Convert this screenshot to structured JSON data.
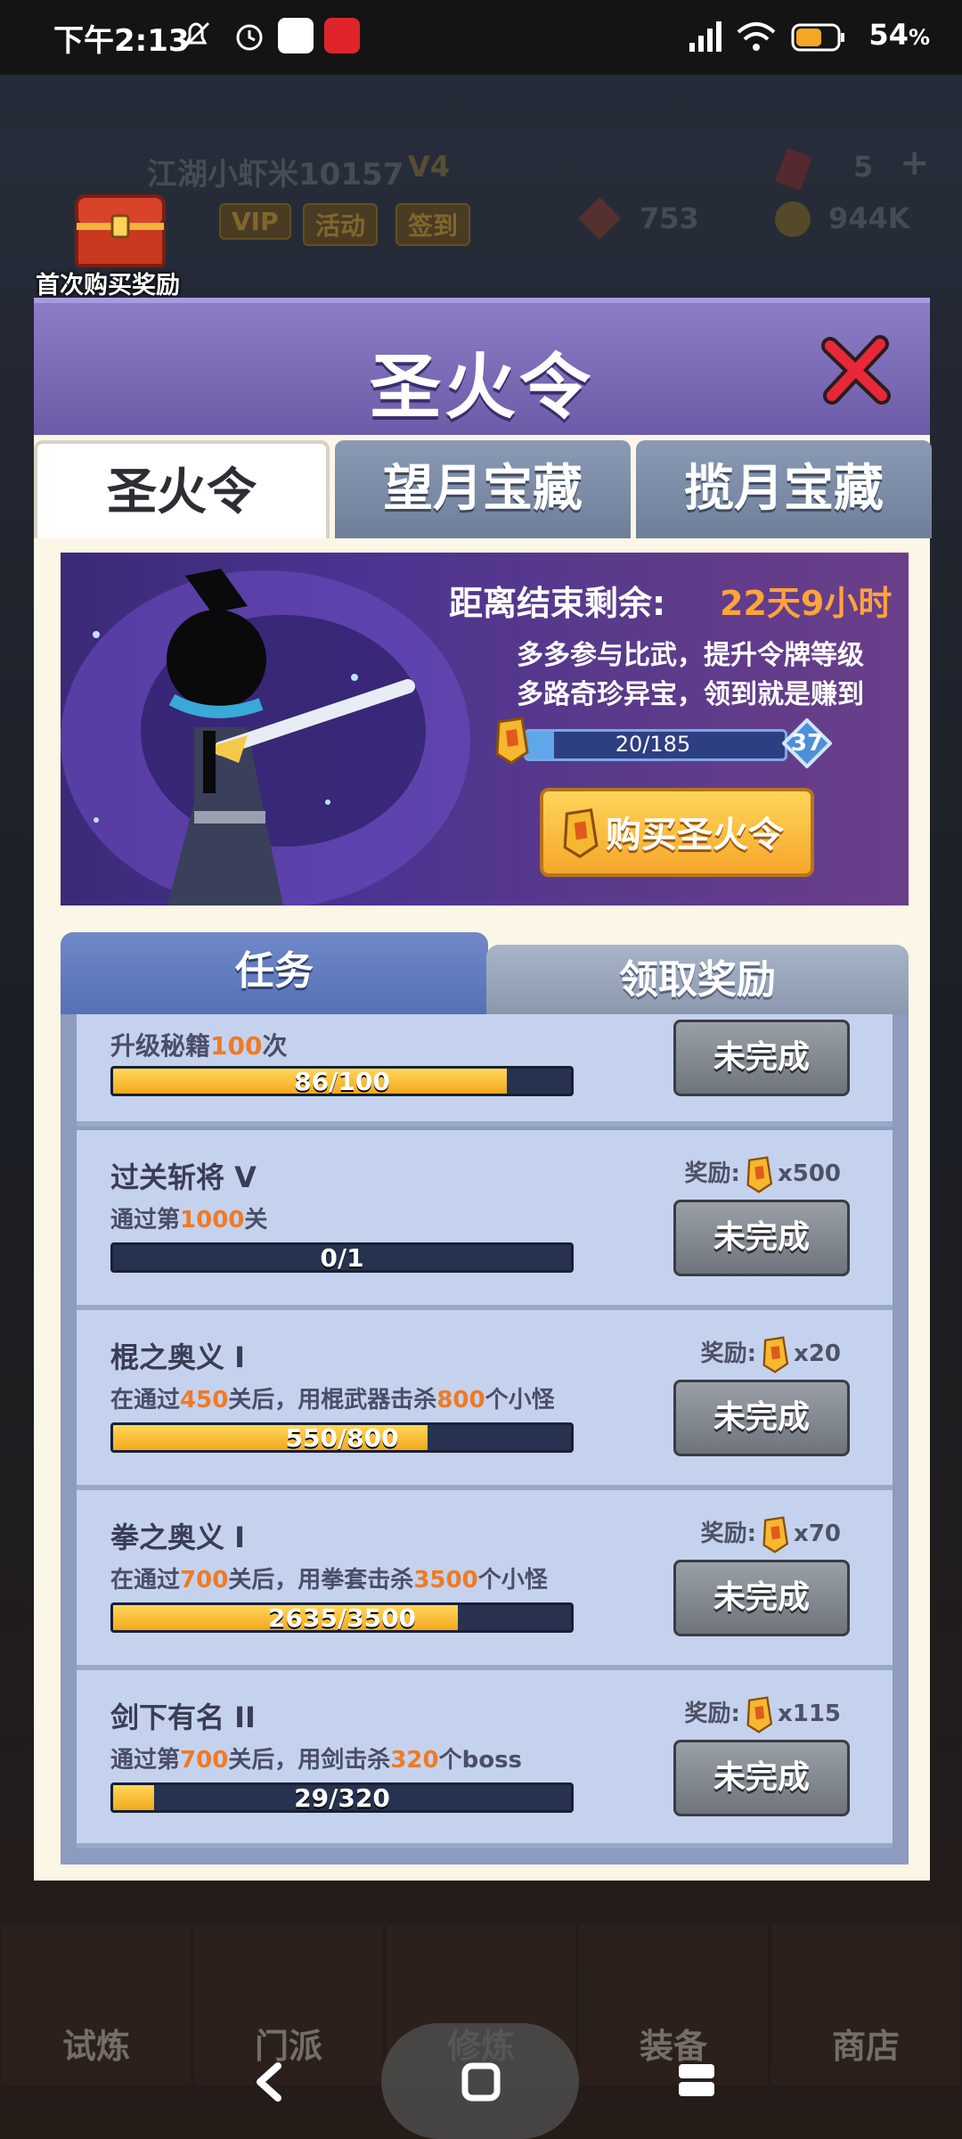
{
  "status_bar": {
    "time": "下午2:13",
    "battery": "54",
    "battery_unit": "%"
  },
  "background": {
    "player_name": "江湖小虾米10157",
    "vip_level": "V4",
    "buttons": [
      "VIP",
      "活动",
      "签到"
    ],
    "gems": "5",
    "currency_a": "753",
    "currency_b": "944K",
    "first_buy_label": "首次购买奖励"
  },
  "modal": {
    "title": "圣火令",
    "tabs": [
      "圣火令",
      "望月宝藏",
      "揽月宝藏"
    ],
    "active_tab": 0,
    "banner": {
      "remaining_label": "距离结束剩余:",
      "remaining_value": "22天9小时",
      "slogan1": "多多参与比武，提升令牌等级",
      "slogan2": "多路奇珍异宝，领到就是赚到",
      "progress_text": "20/185",
      "progress": 0.108,
      "level": "37",
      "buy_label": "购买圣火令"
    },
    "section_tabs": {
      "tasks": "任务",
      "rewards": "领取奖励"
    },
    "tasks": [
      {
        "title": "",
        "desc": [
          "升级秘籍",
          "100",
          "次"
        ],
        "progress_text": "86/100",
        "progress": 0.86,
        "reward": "",
        "status": "未完成"
      },
      {
        "title": "过关斩将 V",
        "desc": [
          "通过第",
          "1000",
          "关"
        ],
        "progress_text": "0/1",
        "progress": 0.0,
        "reward_label": "奖励:",
        "reward": "x500",
        "status": "未完成"
      },
      {
        "title": "棍之奥义 I",
        "desc": [
          "在通过",
          "450",
          "关后，用棍武器击杀",
          "800",
          "个小怪"
        ],
        "progress_text": "550/800",
        "progress": 0.6875,
        "reward_label": "奖励:",
        "reward": "x20",
        "status": "未完成"
      },
      {
        "title": "拳之奥义 I",
        "desc": [
          "在通过",
          "700",
          "关后，用拳套击杀",
          "3500",
          "个小怪"
        ],
        "progress_text": "2635/3500",
        "progress": 0.753,
        "reward_label": "奖励:",
        "reward": "x70",
        "status": "未完成"
      },
      {
        "title": "剑下有名 II",
        "desc": [
          "通过第",
          "700",
          "关后，用剑击杀",
          "320",
          "个boss"
        ],
        "progress_text": "29/320",
        "progress": 0.09,
        "reward_label": "奖励:",
        "reward": "x115",
        "status": "未完成"
      }
    ]
  },
  "bottom_nav": [
    "试炼",
    "门派",
    "修炼",
    "装备",
    "商店"
  ],
  "colors": {
    "accent": "#f07a23",
    "header": "#7563b0",
    "gold": "#f5a62a"
  }
}
